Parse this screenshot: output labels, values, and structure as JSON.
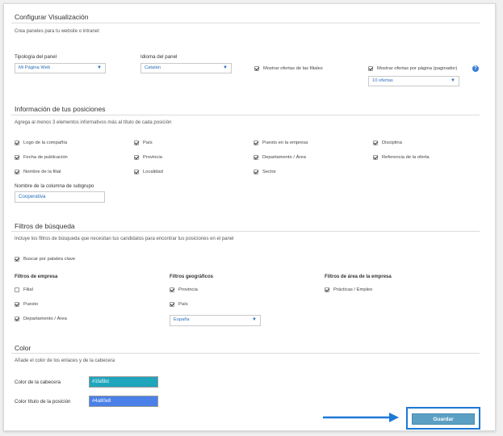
{
  "sections": {
    "display": {
      "title": "Configurar Visualización",
      "description": "Crea paneles para tu website o intranet",
      "panel_type_label": "Tipología del panel",
      "panel_type_value": "Mi Página Web",
      "language_label": "Idioma del panel",
      "language_value": "Catalán",
      "show_subsidiary_offers": "Mostrar ofertas de las filiales",
      "show_offers_per_page": "Mostrar ofertas por página (paginador)",
      "offers_per_page_value": "10 ofertas"
    },
    "positions": {
      "title": "Información de tus posiciones",
      "description": "Agrega al menos 3 elementos informativos más al título de cada posición",
      "items": [
        {
          "label": "Logo de la compañía",
          "checked": true
        },
        {
          "label": "País",
          "checked": true
        },
        {
          "label": "Puesto en la empresa",
          "checked": true
        },
        {
          "label": "Disciplina",
          "checked": true
        },
        {
          "label": "Fecha de publicación",
          "checked": true
        },
        {
          "label": "Provincia",
          "checked": true
        },
        {
          "label": "Departamento / Área",
          "checked": true
        },
        {
          "label": "Referencia de la oferta",
          "checked": true
        },
        {
          "label": "Nombre de la filial",
          "checked": true
        },
        {
          "label": "Localidad",
          "checked": true
        },
        {
          "label": "Sector",
          "checked": true
        }
      ],
      "subgroup_label": "Nombre de la columna de subgrupo",
      "subgroup_value": "Cooperativa"
    },
    "filters": {
      "title": "Filtros de búsqueda",
      "description": "Incluye los filtros de búsqueda que necesitan tus candidatos para encontrar tus posiciones en el panel",
      "keyword_search": "Buscar por palabra clave",
      "company_filters_title": "Filtros de empresa",
      "company_filters": [
        {
          "label": "Filial",
          "checked": false
        },
        {
          "label": "Puesto",
          "checked": true
        },
        {
          "label": "Departamento / Área",
          "checked": true
        }
      ],
      "geo_filters_title": "Filtros geográficos",
      "geo_filters": [
        {
          "label": "Provincia",
          "checked": true
        },
        {
          "label": "País",
          "checked": true
        }
      ],
      "country_value": "España",
      "area_filters_title": "Filtros de área de la empresa",
      "area_filters": [
        {
          "label": "Prácticas / Empleo",
          "checked": true
        }
      ]
    },
    "color": {
      "title": "Color",
      "description": "Añade el color de los enlaces y de la cabecera",
      "header_color_label": "Color de la cabecera",
      "header_color_value": "#1fa5bc",
      "title_color_label": "Color título de la posición",
      "title_color_value": "#4a80e8"
    }
  },
  "actions": {
    "save_label": "Guardar"
  },
  "colors": {
    "accent_blue": "#1e78d6",
    "save_button": "#5b9fc4",
    "arrow": "#1e78d6"
  },
  "icons": {
    "help": "question-mark-circle-icon",
    "dropdown": "caret-down-icon",
    "arrow": "arrow-right-icon"
  }
}
